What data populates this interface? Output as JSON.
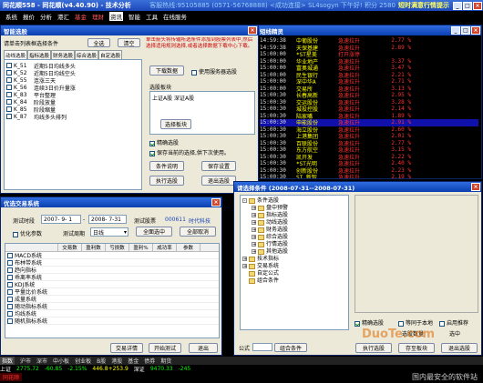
{
  "app": {
    "title": "同花顺558 - 同花顺(v4.40.90) - 技术分析",
    "right_info": "客服热线:95105885 (0571-56768888)  <成功连接>  SL4sogyn 下午好!  积分  2580",
    "right_ad": "短时满意行情提示"
  },
  "menu": [
    "系统",
    "报价",
    "分析",
    "港汇",
    "基金",
    "理财",
    "资讯",
    "智能",
    "工具",
    "在线服务"
  ],
  "smart": {
    "title": "智能选股",
    "cond_label": "请单击列表框选择条件",
    "btn_all": "全选",
    "btn_clear": "清空",
    "tabs": [
      "动线选股",
      "指标选股",
      "财务选股",
      "综合选股",
      "自定选股"
    ],
    "items": [
      {
        "code": "K_51",
        "name": "近期5日均线多头"
      },
      {
        "code": "K_52",
        "name": "近期5日均线空头"
      },
      {
        "code": "K_55",
        "name": "连涨三天"
      },
      {
        "code": "K_56",
        "name": "连续3日价升量涨"
      },
      {
        "code": "K_83",
        "name": "平台整理"
      },
      {
        "code": "K_84",
        "name": "阶段放量"
      },
      {
        "code": "K_85",
        "name": "阶段缩量"
      },
      {
        "code": "K_87",
        "name": "均线多头排列"
      }
    ],
    "tip": "单击箭头将传输所选条件添加到股票列表中,然后选择适用规则选择,或者选择数据下载中心下载。",
    "btn_download": "下载数据",
    "chk_server": "使用服务器选股",
    "section_label": "选股板块",
    "range": "上证A股  深证A股",
    "btn_range": "选择板块",
    "chk_precise": "精确选股",
    "chk_save": "保存当前的选择,供下次使用。",
    "btn_cond": "条件说明",
    "btn_save": "保存设置",
    "btn_run": "执行选股",
    "btn_exit": "退出选股"
  },
  "radar": {
    "title": "短线精灵",
    "rows": [
      {
        "t": "14:59:38",
        "n": "中葡股份",
        "e": "急速拉升",
        "v": "2.77 %"
      },
      {
        "t": "14:59:38",
        "n": "天保基建",
        "e": "急速拉升",
        "v": "2.89 %"
      },
      {
        "t": "15:00:00",
        "n": "*ST星美",
        "e": "打开涨停",
        "v": ""
      },
      {
        "t": "15:00:00",
        "n": "华业地产",
        "e": "急速拉升",
        "v": "3.37 %"
      },
      {
        "t": "15:00:00",
        "n": "富奥城通",
        "e": "急速拉升",
        "v": "3.47 %"
      },
      {
        "t": "15:00:00",
        "n": "民生银行",
        "e": "急速拉升",
        "v": "2.21 %"
      },
      {
        "t": "15:00:00",
        "n": "深中华A",
        "e": "急速拉升",
        "v": "2.71 %"
      },
      {
        "t": "15:00:00",
        "n": "交易所",
        "e": "急速拉升",
        "v": "3.13 %"
      },
      {
        "t": "15:00:30",
        "n": "长春高新",
        "e": "急速拉升",
        "v": "2.95 %"
      },
      {
        "t": "15:00:30",
        "n": "交运股份",
        "e": "急速拉升",
        "v": "3.28 %"
      },
      {
        "t": "15:00:30",
        "n": "城投控股",
        "e": "急速拉升",
        "v": "2.14 %"
      },
      {
        "t": "15:00:30",
        "n": "陆家嘴",
        "e": "急速拉升",
        "v": "1.89 %"
      },
      {
        "t": "15:00:30",
        "n": "申能股份",
        "e": "急速拉升",
        "v": "2.91 %"
      },
      {
        "t": "15:00:30",
        "n": "海立股份",
        "e": "急速拉升",
        "v": "2.60 %"
      },
      {
        "t": "15:00:30",
        "n": "上港集团",
        "e": "急速拉升",
        "v": "2.01 %"
      },
      {
        "t": "15:00:30",
        "n": "百联股份",
        "e": "急速拉升",
        "v": "2.77 %"
      },
      {
        "t": "15:00:30",
        "n": "东方航空",
        "e": "急速拉升",
        "v": "3.15 %"
      },
      {
        "t": "15:00:30",
        "n": "凯开发",
        "e": "急速拉升",
        "v": "2.22 %"
      },
      {
        "t": "15:00:30",
        "n": "*ST光明",
        "e": "急速拉升",
        "v": "2.40 %"
      },
      {
        "t": "15:00:30",
        "n": "创新股份",
        "e": "急速拉升",
        "v": "2.23 %"
      },
      {
        "t": "15:00:30",
        "n": "ST 新智",
        "e": "急速拉升",
        "v": "2.19 %"
      }
    ]
  },
  "tradesel": {
    "title": "优选交易系统",
    "period_label": "测试时段",
    "date_from": "2007- 9- 1",
    "date_to": "2008- 7-31",
    "test_stock_label": "测试股票",
    "stock_code": "000611",
    "stock_name": "时代科技",
    "chk_optimize": "优化参数",
    "cycle_label": "测试周期",
    "cycle_value": "日线",
    "btn_all": "全面选中",
    "btn_clear": "全部取消",
    "columns": [
      "",
      "交易数",
      "盈利数",
      "亏损数",
      "盈利%",
      "成功率",
      "参数"
    ],
    "systems": [
      "MACD系统",
      "布林带系统",
      "趋向指标",
      "乖离率系统",
      "KDJ系统",
      "平量比价系统",
      "成量系统",
      "随动指标系统",
      "均线系统",
      "随机指标系统"
    ],
    "btn_detail": "交易详情",
    "btn_start": "开始测试",
    "btn_exit": "退出"
  },
  "formula": {
    "title": "请选择条件 (2008-07-31--2008-07-31)",
    "tree": [
      {
        "l": 0,
        "t": "条件选股",
        "exp": "-"
      },
      {
        "l": 1,
        "t": "盘中预警",
        "exp": "+"
      },
      {
        "l": 1,
        "t": "指标选股",
        "exp": "+"
      },
      {
        "l": 1,
        "t": "动线选股",
        "exp": "+"
      },
      {
        "l": 1,
        "t": "财务选股",
        "exp": "+"
      },
      {
        "l": 1,
        "t": "综合选股",
        "exp": "+"
      },
      {
        "l": 1,
        "t": "行情选股",
        "exp": "+"
      },
      {
        "l": 1,
        "t": "其他选股",
        "exp": "+"
      },
      {
        "l": 0,
        "t": "技术指标",
        "exp": "+"
      },
      {
        "l": 0,
        "t": "交易系统",
        "exp": "+"
      },
      {
        "l": 0,
        "t": "自定公式",
        "exp": ""
      },
      {
        "l": 0,
        "t": "组合条件",
        "exp": ""
      }
    ],
    "lbl_formula": "公式",
    "btn_combo": "组合条件",
    "chk_precise": "精确选股",
    "chk_same": "等同于本地",
    "chk_use": "启用推荐",
    "lbl_select": "选股数量",
    "lbl_chosen": "选中",
    "btn_run": "执行选股",
    "btn_save": "存至板块",
    "btn_exit": "退出选股"
  },
  "bottom": {
    "tabs": [
      "指数",
      "沪市",
      "深市",
      "中小板",
      "创业板",
      "B股",
      "港股",
      "基金",
      "债券",
      "期货"
    ],
    "ticker": [
      {
        "label": "上证",
        "v": "2775.72",
        "c": "-60.85",
        "p": "-2.15%"
      },
      {
        "label": "",
        "v": "446.8+253.9",
        "c": "",
        "p": ""
      },
      {
        "label": "深证",
        "v": "9470.33",
        "c": "-245",
        "p": ""
      }
    ],
    "status_right": "同花顺"
  },
  "watermark": {
    "site": "DuoTe.com",
    "slogan": "国内最安全的软件站"
  },
  "colors": {
    "title": "#1c47b8",
    "rise": "#ff3030",
    "fall": "#00e000",
    "hi": "#3333ff"
  }
}
